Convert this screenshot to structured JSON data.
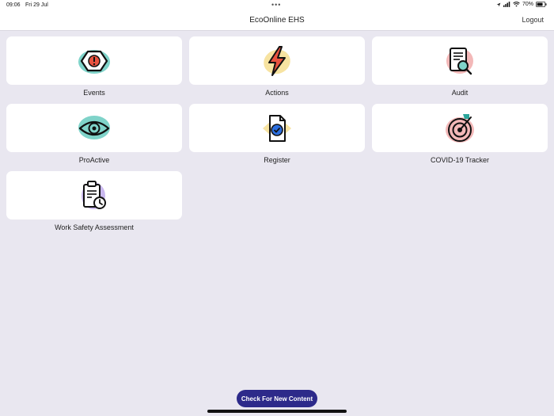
{
  "status": {
    "time": "09:06",
    "date": "Fri 29 Jul",
    "dots": "•••",
    "battery": "70%"
  },
  "nav": {
    "title": "EcoOnline EHS",
    "logout": "Logout"
  },
  "tiles": [
    {
      "label": "Events",
      "icon": "alert-hexagon-icon"
    },
    {
      "label": "Actions",
      "icon": "lightning-bolt-icon"
    },
    {
      "label": "Audit",
      "icon": "document-search-icon"
    },
    {
      "label": "ProActive",
      "icon": "eye-icon"
    },
    {
      "label": "Register",
      "icon": "document-check-icon"
    },
    {
      "label": "COVID-19 Tracker",
      "icon": "target-icon"
    },
    {
      "label": "Work Safety Assessment",
      "icon": "clipboard-clock-icon"
    }
  ],
  "footer": {
    "check_button": "Check For New Content"
  },
  "colors": {
    "background": "#e9e7f0",
    "button": "#2d2a8a",
    "icon_teal": "#7fd3c9",
    "icon_red": "#e8523f",
    "icon_yellow": "#f7e3a1",
    "icon_pink": "#f3b8b8",
    "icon_blue": "#2b6fe0",
    "icon_purple": "#c9b8ee"
  }
}
